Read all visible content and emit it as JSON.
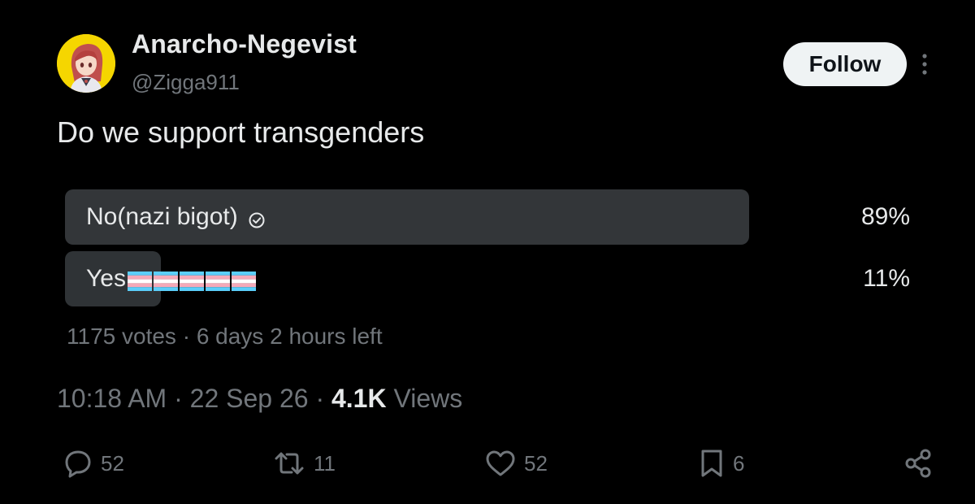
{
  "user": {
    "display_name": "Anarcho-Negevist",
    "handle": "@Zigga911",
    "avatar": "anime-avatar"
  },
  "header": {
    "follow_label": "Follow",
    "more_icon": "more-vertical-icon"
  },
  "tweet": {
    "text": "Do we support transgenders"
  },
  "poll": {
    "options": [
      {
        "label": "No(nazi bigot)",
        "percent_text": "89%",
        "percent": 89,
        "winner": true,
        "icon": "check-circle-icon"
      },
      {
        "label": "Yes",
        "percent_text": "11%",
        "percent": 11,
        "winner": false,
        "icon": "transgender-flag-icon",
        "flag_count": 5
      }
    ],
    "votes": "1175 votes",
    "separator": "·",
    "time_left": "6 days 2 hours left"
  },
  "meta": {
    "time": "10:18 AM",
    "separator": "·",
    "date": "22 Sep 26",
    "views_count": "4.1K",
    "views_label": "Views"
  },
  "actions": {
    "replies": "52",
    "reposts": "11",
    "likes": "52",
    "bookmarks": "6"
  },
  "colors": {
    "background": "#000000",
    "text_primary": "#e7e9ea",
    "text_secondary": "#71767b",
    "poll_winner_bar": "#333639",
    "poll_other_bar": "#2f3336",
    "follow_bg": "#eff3f4",
    "avatar_ring": "#f5d600",
    "flag_blue": "#5bcefa",
    "flag_pink": "#f5a9b8",
    "flag_white": "#ffffff"
  }
}
